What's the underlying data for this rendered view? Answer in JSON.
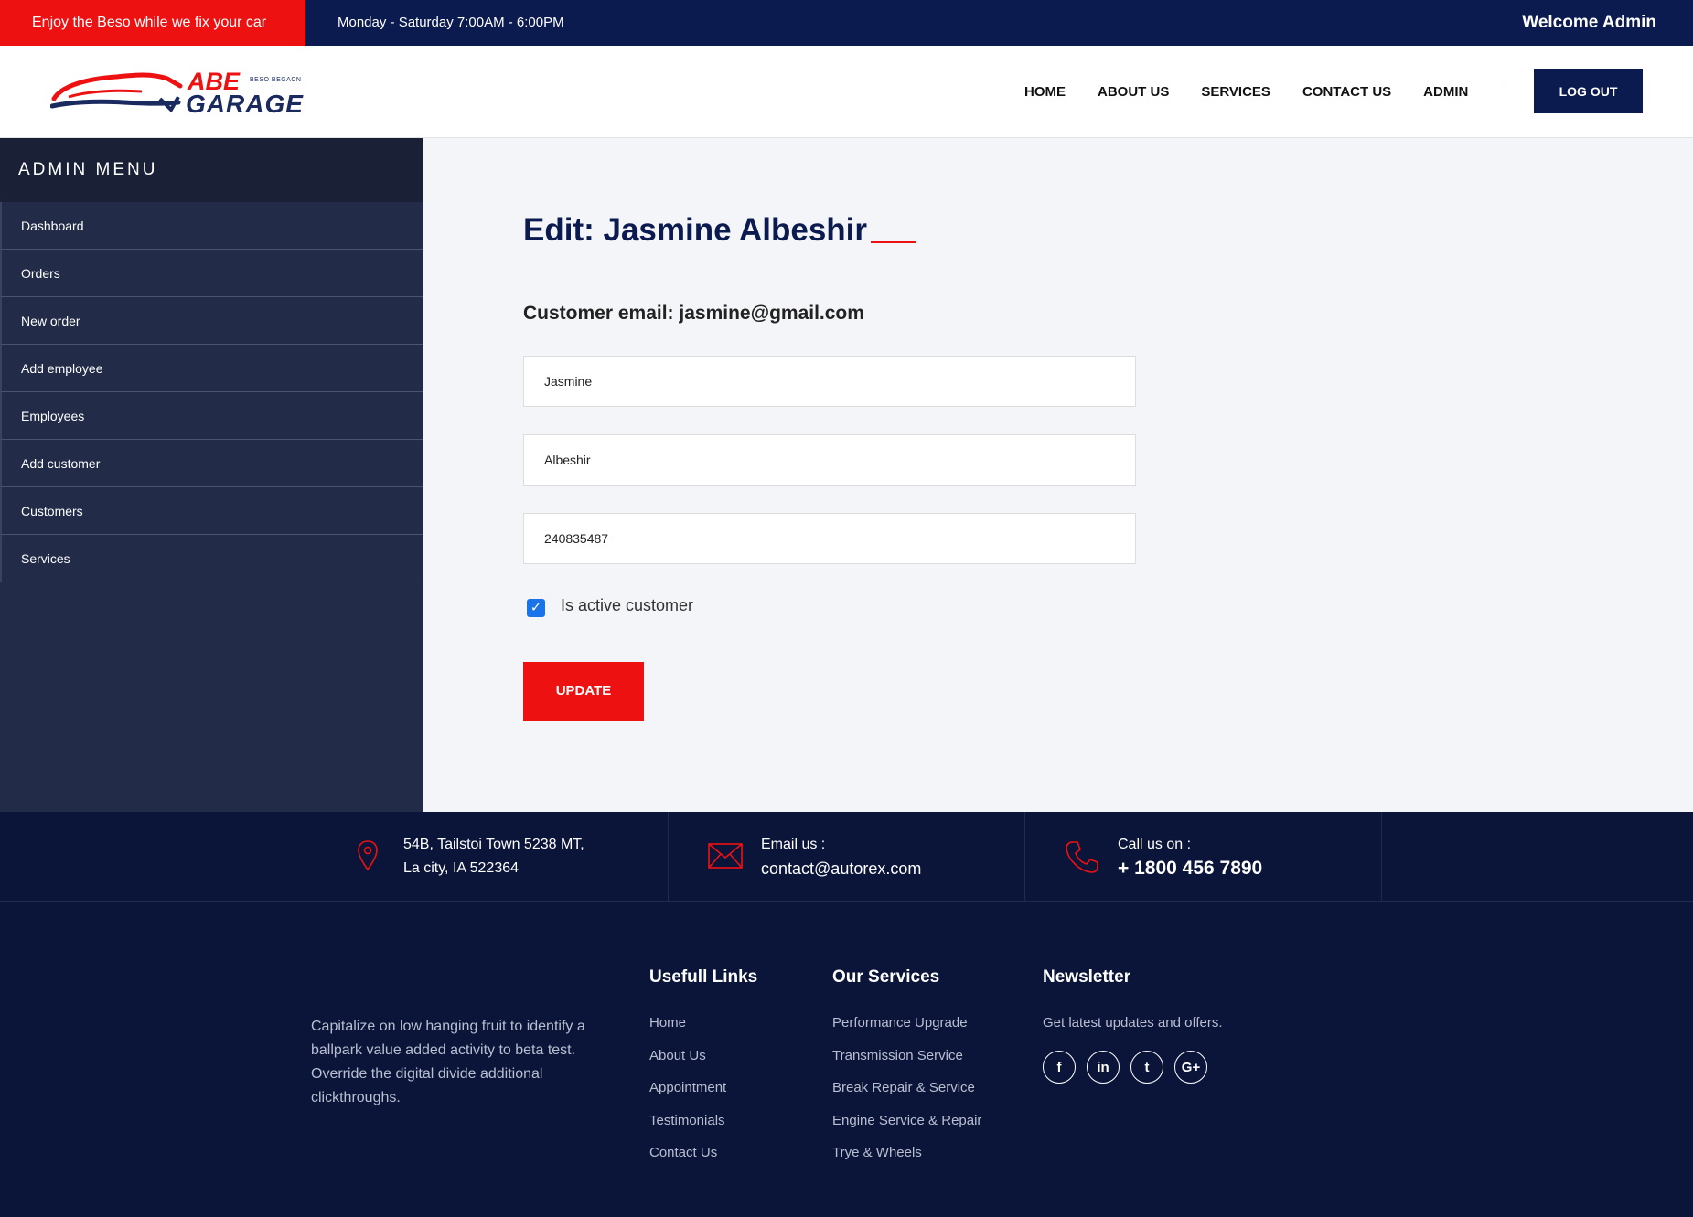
{
  "topbar": {
    "promo": "Enjoy the Beso while we fix your car",
    "hours": "Monday - Saturday 7:00AM - 6:00PM",
    "welcome": "Welcome Admin"
  },
  "header": {
    "logo_abe": "ABE",
    "logo_sub": "BESO BEGACN",
    "logo_garage": "GARAGE",
    "nav": [
      "HOME",
      "ABOUT US",
      "SERVICES",
      "CONTACT US",
      "ADMIN"
    ],
    "logout": "LOG OUT"
  },
  "sidebar": {
    "title": "ADMIN MENU",
    "items": [
      "Dashboard",
      "Orders",
      "New order",
      "Add employee",
      "Employees",
      "Add customer",
      "Customers",
      "Services"
    ]
  },
  "form": {
    "title": "Edit: Jasmine Albeshir",
    "email_label": "Customer email: jasmine@gmail.com",
    "first_name": "Jasmine",
    "last_name": "Albeshir",
    "phone": "240835487",
    "active_label": "Is active customer",
    "active_checked": true,
    "update": "UPDATE"
  },
  "contact": {
    "address_line1": "54B, Tailstoi Town 5238 MT,",
    "address_line2": "La city, IA 522364",
    "email_label": "Email us :",
    "email": "contact@autorex.com",
    "call_label": "Call us on :",
    "phone": "+ 1800 456 7890"
  },
  "footer": {
    "about": "Capitalize on low hanging fruit to identify a ballpark value added activity to beta test. Override the digital divide additional clickthroughs.",
    "links_title": "Usefull Links",
    "links": [
      "Home",
      "About Us",
      "Appointment",
      "Testimonials",
      "Contact Us"
    ],
    "services_title": "Our Services",
    "services": [
      "Performance Upgrade",
      "Transmission Service",
      "Break Repair & Service",
      "Engine Service & Repair",
      "Trye & Wheels"
    ],
    "newsletter_title": "Newsletter",
    "newsletter_text": "Get latest updates and offers.",
    "socials": [
      "f",
      "in",
      "t",
      "G+"
    ]
  },
  "colors": {
    "brand_red": "#ee1111",
    "brand_navy": "#0b1a4f",
    "checkbox_blue": "#1a73e8"
  }
}
